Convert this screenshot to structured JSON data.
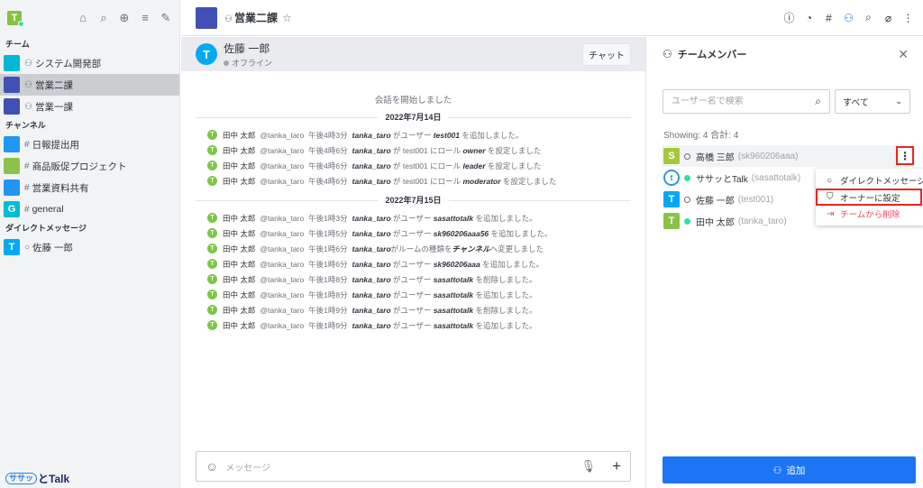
{
  "sidebar": {
    "avatar_letter": "T",
    "tool_icons": [
      "home-icon",
      "search-icon",
      "directory-icon",
      "sort-icon",
      "create-new-icon"
    ],
    "sections": {
      "teams": "チーム",
      "channels": "チャンネル",
      "direct": "ダイレクトメッセージ"
    },
    "teams": [
      {
        "label": "システム開発部",
        "color": "#03b8d4",
        "active": false
      },
      {
        "label": "営業二課",
        "color": "#3f51b5",
        "active": true
      },
      {
        "label": "営業一課",
        "color": "#3f51b5",
        "active": false
      }
    ],
    "channels": [
      {
        "label": "日報提出用",
        "color": "#2196f3",
        "type": "#",
        "letter": ""
      },
      {
        "label": "商品販促プロジェクト",
        "color": "#8bc34a",
        "type": "#",
        "letter": ""
      },
      {
        "label": "営業資料共有",
        "color": "#2196f3",
        "type": "#",
        "letter": ""
      },
      {
        "label": "general",
        "color": "#00bcd4",
        "type": "#",
        "letter": "G"
      }
    ],
    "direct": [
      {
        "label": "佐藤 一郎",
        "color": "#03a9f4",
        "letter": "T"
      }
    ],
    "logo_pill": "ササッ",
    "logo_rest": "とTalk"
  },
  "header": {
    "room_name": "営業二課",
    "tool_icons": [
      "info-icon",
      "threads-icon",
      "channels-icon",
      "members-icon",
      "search-icon",
      "files-icon",
      "kebab-icon"
    ]
  },
  "chat": {
    "user_name": "佐藤 一郎",
    "user_status": "オフライン",
    "user_avatar": "T",
    "chat_button": "チャット",
    "start_text": "会話を開始しました",
    "days": [
      {
        "date": "2022年7月14日",
        "messages": [
          {
            "name": "田中 太郎",
            "at": "@tanka_taro",
            "time": "午後4時3分",
            "actor": "tanka_taro",
            "text1": " がユーザー ",
            "target": "test001",
            "text2": " を追加しました。"
          },
          {
            "name": "田中 太郎",
            "at": "@tanka_taro",
            "time": "午後4時6分",
            "actor": "tanka_taro",
            "text1": " が test001 にロール ",
            "target": "owner",
            "text2": " を設定しました"
          },
          {
            "name": "田中 太郎",
            "at": "@tanka_taro",
            "time": "午後4時6分",
            "actor": "tanka_taro",
            "text1": " が test001 にロール ",
            "target": "leader",
            "text2": " を設定しました"
          },
          {
            "name": "田中 太郎",
            "at": "@tanka_taro",
            "time": "午後4時6分",
            "actor": "tanka_taro",
            "text1": " が test001 にロール ",
            "target": "moderator",
            "text2": " を設定しました"
          }
        ]
      },
      {
        "date": "2022年7月15日",
        "messages": [
          {
            "name": "田中 太郎",
            "at": "@tanka_taro",
            "time": "午後1時3分",
            "actor": "tanka_taro",
            "text1": " がユーザー ",
            "target": "sasattotalk",
            "text2": " を追加しました。"
          },
          {
            "name": "田中 太郎",
            "at": "@tanka_taro",
            "time": "午後1時5分",
            "actor": "tanka_taro",
            "text1": " がユーザー ",
            "target": "sk960206aaa56",
            "text2": " を追加しました。"
          },
          {
            "name": "田中 太郎",
            "at": "@tanka_taro",
            "time": "午後1時6分",
            "actor": "tanka_taro",
            "text1": "がルームの種類を",
            "target": "チャンネル",
            "text2": "へ変更しました"
          },
          {
            "name": "田中 太郎",
            "at": "@tanka_taro",
            "time": "午後1時6分",
            "actor": "tanka_taro",
            "text1": " がユーザー ",
            "target": "sk960206aaa",
            "text2": " を追加しました。"
          },
          {
            "name": "田中 太郎",
            "at": "@tanka_taro",
            "time": "午後1時8分",
            "actor": "tanka_taro",
            "text1": " がユーザー ",
            "target": "sasattotalk",
            "text2": " を削除しました。"
          },
          {
            "name": "田中 太郎",
            "at": "@tanka_taro",
            "time": "午後1時8分",
            "actor": "tanka_taro",
            "text1": " がユーザー ",
            "target": "sasattotalk",
            "text2": " を追加しました。"
          },
          {
            "name": "田中 太郎",
            "at": "@tanka_taro",
            "time": "午後1時9分",
            "actor": "tanka_taro",
            "text1": " がユーザー ",
            "target": "sasattotalk",
            "text2": " を削除しました。"
          },
          {
            "name": "田中 太郎",
            "at": "@tanka_taro",
            "time": "午後1時9分",
            "actor": "tanka_taro",
            "text1": " がユーザー ",
            "target": "sasattotalk",
            "text2": " を追加しました。"
          }
        ]
      }
    ],
    "composer_placeholder": "メッセージ"
  },
  "panel": {
    "title": "チームメンバー",
    "search_placeholder": "ユーザー名で検索",
    "filter_value": "すべて",
    "showing": "Showing: 4  合計: 4",
    "members": [
      {
        "name": "高橋 三郎",
        "username": "(sk960206aaa)",
        "letter": "S",
        "color": "#a5c83a",
        "online": false,
        "bot": false
      },
      {
        "name": "ササッとTalk",
        "username": "(sasattotalk)",
        "letter": "t",
        "color": "#2a9bd6",
        "online": true,
        "bot": true
      },
      {
        "name": "佐藤 一郎",
        "username": "(test001)",
        "letter": "T",
        "color": "#03a9f4",
        "online": false,
        "bot": false
      },
      {
        "name": "田中 太郎",
        "username": "(tanka_taro)",
        "letter": "T",
        "color": "#8bc34a",
        "online": true,
        "bot": false
      }
    ],
    "menu": {
      "dm": "ダイレクトメッセージ",
      "set_owner": "オーナーに設定",
      "remove": "チームから削除"
    },
    "add_button": "追加"
  },
  "colors": {
    "accent": "#1d74f5",
    "highlight_box": "#e8261f",
    "danger": "#f5455c",
    "online": "#2de0a5"
  }
}
